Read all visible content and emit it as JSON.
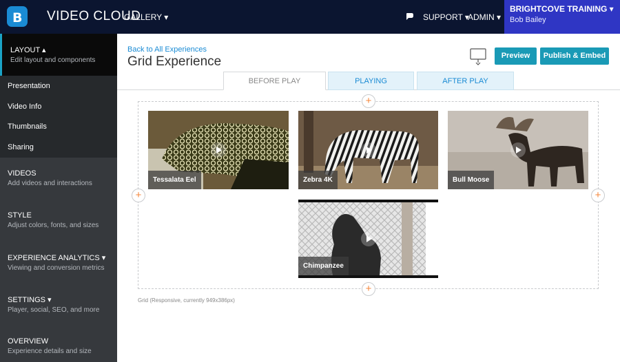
{
  "header": {
    "app_name": "VIDEO CLOUD",
    "gallery_menu": "GALLERY ▾",
    "support_menu": "SUPPORT ▾",
    "admin_menu": "ADMIN ▾",
    "account": {
      "name": "BRIGHTCOVE TRAINING ▾",
      "user": "Bob Bailey"
    },
    "colors": {
      "bar": "#0b1530",
      "account_bg": "#2f36c4",
      "logo": "#1a8bd4"
    }
  },
  "sidebar": {
    "layout": {
      "title": "LAYOUT ▴",
      "desc": "Edit layout and components"
    },
    "sub_items": [
      "Presentation",
      "Video Info",
      "Thumbnails",
      "Sharing"
    ],
    "sections": [
      {
        "title": "VIDEOS",
        "desc": "Add videos and interactions"
      },
      {
        "title": "STYLE",
        "desc": "Adjust colors, fonts, and sizes"
      },
      {
        "title": "EXPERIENCE ANALYTICS ▾",
        "desc": "Viewing and conversion metrics"
      },
      {
        "title": "SETTINGS ▾",
        "desc": "Player, social, SEO, and more"
      },
      {
        "title": "OVERVIEW",
        "desc": "Experience details and size"
      }
    ]
  },
  "main": {
    "back_link": "Back to All Experiences",
    "title": "Grid Experience",
    "preview_button": "Preview",
    "publish_button": "Publish & Embed",
    "accent_color": "#1a9ab6",
    "tabs": [
      {
        "label": "BEFORE PLAY",
        "active": true
      },
      {
        "label": "PLAYING",
        "active": false
      },
      {
        "label": "AFTER PLAY",
        "active": false
      }
    ],
    "videos": [
      {
        "title": "Tessalata Eel",
        "icon": "eel-thumbnail"
      },
      {
        "title": "Zebra 4K",
        "icon": "zebra-thumbnail"
      },
      {
        "title": "Bull Moose",
        "icon": "moose-thumbnail"
      },
      {
        "title": "Chimpanzee",
        "icon": "chimpanzee-thumbnail"
      }
    ],
    "add_symbol": "+",
    "grid_caption": "Grid (Responsive, currently 949x386px)"
  }
}
